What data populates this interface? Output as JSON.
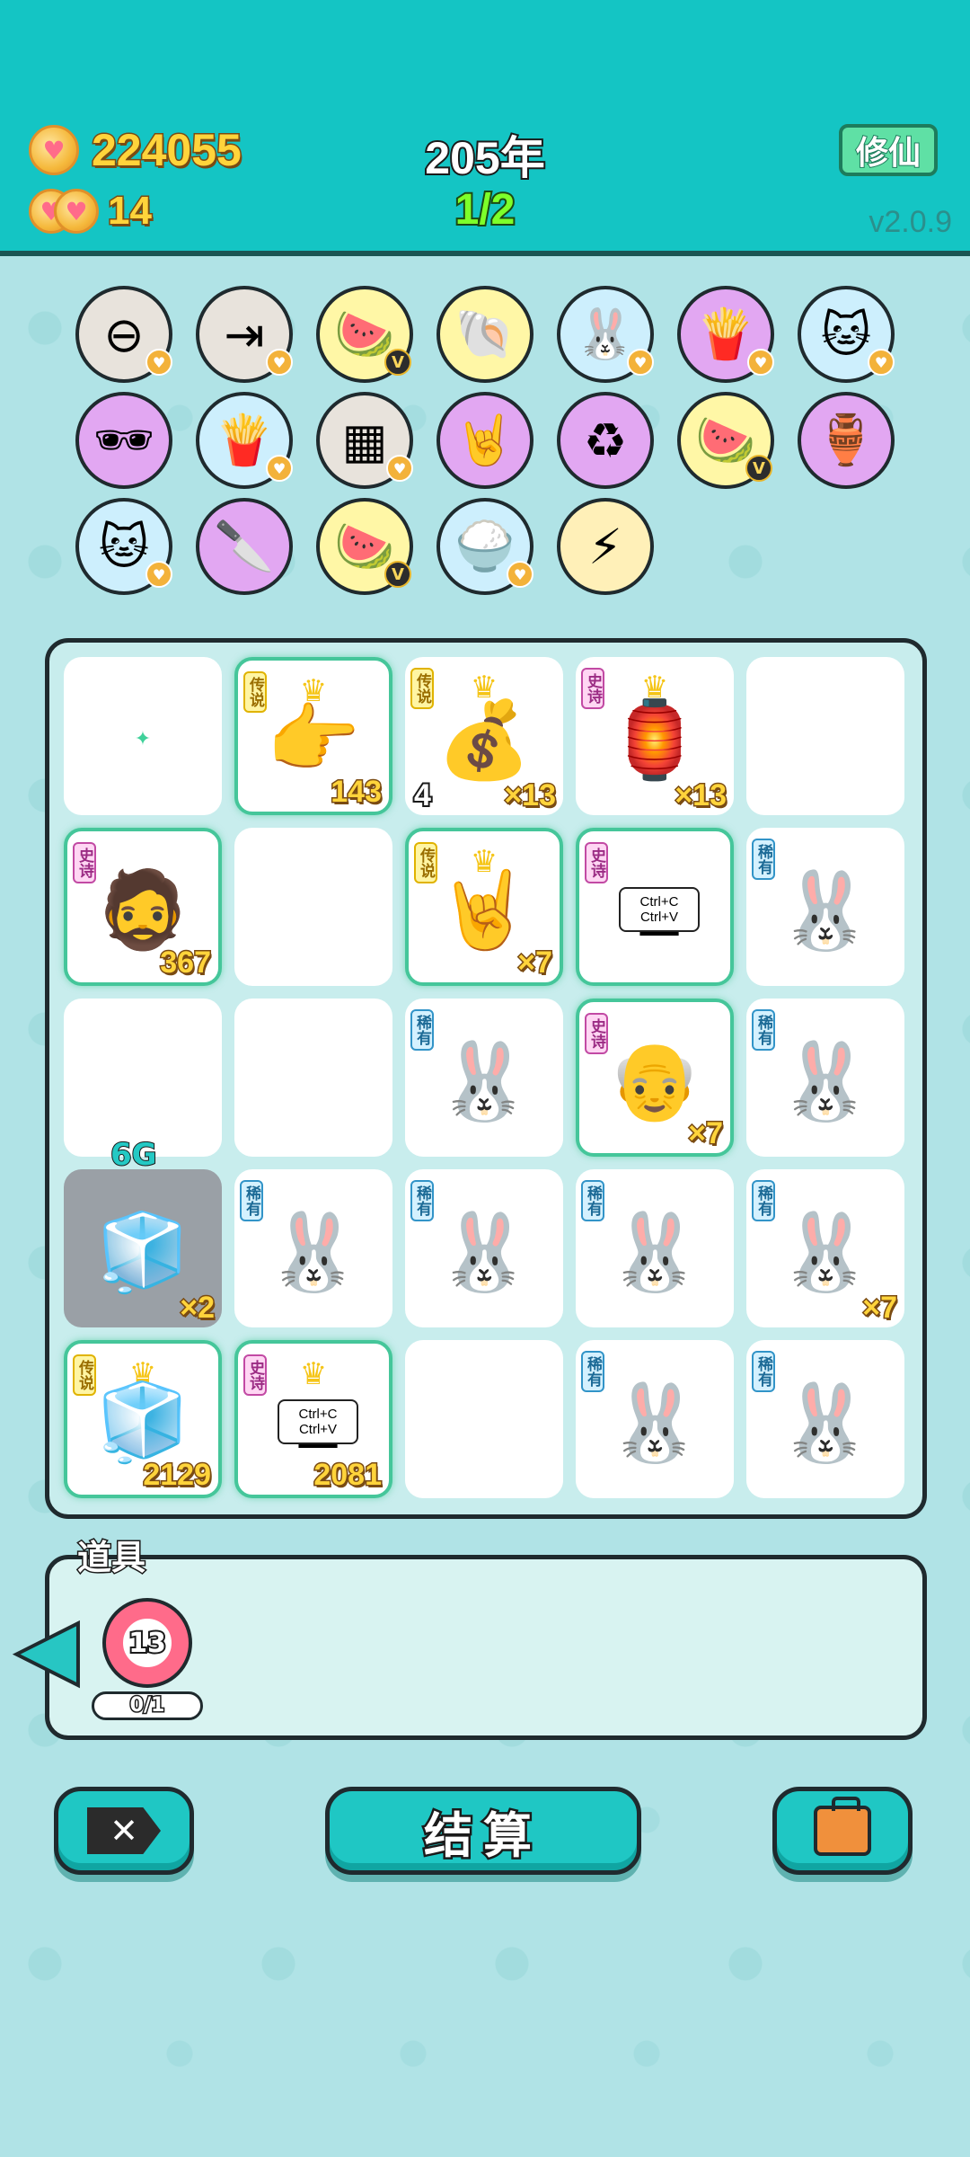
{
  "header": {
    "coins": "224055",
    "secondary": "14",
    "year": "205年",
    "progress": "1/2",
    "mode_button": "修仙",
    "version": "v2.0.9"
  },
  "symbols": [
    {
      "icon": "minus-circle-icon",
      "glyph": "⊖",
      "bg": "#e8e3dc",
      "badge": "heart"
    },
    {
      "icon": "skip-icon",
      "glyph": "⇥",
      "bg": "#e8e3dc",
      "badge": "heart"
    },
    {
      "icon": "fruit-basket-icon",
      "glyph": "🍉",
      "bg": "#fff7a6",
      "badge": "v"
    },
    {
      "icon": "shell-icon",
      "glyph": "🐚",
      "bg": "#fff7a6",
      "badge": ""
    },
    {
      "icon": "rabbit-icon",
      "glyph": "🐰",
      "bg": "#cdeffd",
      "badge": "heart"
    },
    {
      "icon": "fries-icon",
      "glyph": "🍟",
      "bg": "#e2a7f2",
      "badge": "heart"
    },
    {
      "icon": "cat-icon",
      "glyph": "🐱",
      "bg": "#cdeffd",
      "badge": "heart"
    },
    {
      "icon": "sunglasses-icon",
      "glyph": "🕶",
      "bg": "#e2a7f2",
      "badge": ""
    },
    {
      "icon": "fries-icon",
      "glyph": "🍟",
      "bg": "#cdeffd",
      "badge": "heart"
    },
    {
      "icon": "sugar-cubes-icon",
      "glyph": "▦",
      "bg": "#e8e3dc",
      "badge": "heart"
    },
    {
      "icon": "rock-hand-icon",
      "glyph": "🤘",
      "bg": "#e2a7f2",
      "badge": ""
    },
    {
      "icon": "recycle-icon",
      "glyph": "♻",
      "bg": "#e2a7f2",
      "badge": ""
    },
    {
      "icon": "fruit-basket-icon",
      "glyph": "🍉",
      "bg": "#fff7a6",
      "badge": "v"
    },
    {
      "icon": "jar-icon",
      "glyph": "🏺",
      "bg": "#e2a7f2",
      "badge": ""
    },
    {
      "icon": "cat-icon",
      "glyph": "🐱",
      "bg": "#cdeffd",
      "badge": "heart"
    },
    {
      "icon": "cleaver-icon",
      "glyph": "🔪",
      "bg": "#e2a7f2",
      "badge": ""
    },
    {
      "icon": "fruit-basket-icon",
      "glyph": "🍉",
      "bg": "#fff7a6",
      "badge": "v"
    },
    {
      "icon": "rice-bowl-icon",
      "glyph": "🍚",
      "bg": "#cdeffd",
      "badge": "heart"
    },
    {
      "icon": "lightning-icon",
      "glyph": "⚡",
      "bg": "#fff0b8",
      "badge": ""
    }
  ],
  "board": {
    "cells": [
      {
        "icon": "sparkle-icon",
        "glyph": "✦",
        "rarity": "",
        "count": "",
        "glow": false
      },
      {
        "icon": "pointing-hand-icon",
        "glyph": "👉",
        "rarity": "legend",
        "count": "143",
        "glow": true,
        "crown": true
      },
      {
        "icon": "sack-icon",
        "glyph": "💰",
        "rarity": "legend",
        "count": "×13",
        "left": "4",
        "glow": false,
        "crown": true
      },
      {
        "icon": "lantern-house-icon",
        "glyph": "🏮",
        "rarity": "epic",
        "count": "×13",
        "glow": false,
        "crown": true
      },
      {
        "icon": "",
        "glyph": "",
        "rarity": "",
        "count": "",
        "glow": false
      },
      {
        "icon": "bearded-man-icon",
        "glyph": "🧔",
        "rarity": "epic",
        "count": "367",
        "glow": true
      },
      {
        "icon": "",
        "glyph": "",
        "rarity": "",
        "count": "",
        "glow": false
      },
      {
        "icon": "rock-hand-icon",
        "glyph": "🤘",
        "rarity": "legend",
        "count": "×7",
        "glow": true,
        "crown": true
      },
      {
        "icon": "copy-paste-icon",
        "glyph": "⧉",
        "rarity": "epic",
        "count": "",
        "glow": true,
        "caption": "Ctrl+C Ctrl+V"
      },
      {
        "icon": "rabbit-icon",
        "glyph": "🐰",
        "rarity": "rare",
        "count": "",
        "glow": false
      },
      {
        "icon": "",
        "glyph": "",
        "rarity": "",
        "count": "",
        "glow": false
      },
      {
        "icon": "",
        "glyph": "",
        "rarity": "",
        "count": "",
        "glow": false
      },
      {
        "icon": "rabbit-icon",
        "glyph": "🐰",
        "rarity": "rare",
        "count": "",
        "glow": false
      },
      {
        "icon": "old-man-hat-icon",
        "glyph": "👴",
        "rarity": "epic",
        "count": "×7",
        "glow": true
      },
      {
        "icon": "rabbit-icon",
        "glyph": "🐰",
        "rarity": "rare",
        "count": "",
        "glow": false
      },
      {
        "icon": "fridge-icon",
        "glyph": "🧊",
        "rarity": "",
        "count": "×2",
        "glow": false,
        "special": "6G"
      },
      {
        "icon": "rabbit-icon",
        "glyph": "🐰",
        "rarity": "rare",
        "count": "",
        "glow": false
      },
      {
        "icon": "rabbit-icon",
        "glyph": "🐰",
        "rarity": "rare",
        "count": "",
        "glow": false
      },
      {
        "icon": "rabbit-icon",
        "glyph": "🐰",
        "rarity": "rare",
        "count": "",
        "glow": false
      },
      {
        "icon": "rabbit-icon",
        "glyph": "🐰",
        "rarity": "rare",
        "count": "×7",
        "glow": false
      },
      {
        "icon": "fridge-icon",
        "glyph": "🧊",
        "rarity": "legend",
        "count": "2129",
        "glow": true,
        "crown": true
      },
      {
        "icon": "copy-paste-icon",
        "glyph": "⧉",
        "rarity": "epic",
        "count": "2081",
        "glow": true,
        "crown": true,
        "caption": "Ctrl+C Ctrl+V"
      },
      {
        "icon": "",
        "glyph": "",
        "rarity": "",
        "count": "",
        "glow": false
      },
      {
        "icon": "rabbit-icon",
        "glyph": "🐰",
        "rarity": "rare",
        "count": "",
        "glow": false
      },
      {
        "icon": "rabbit-icon",
        "glyph": "🐰",
        "rarity": "rare",
        "count": "",
        "glow": false
      }
    ]
  },
  "rarity_labels": {
    "legend": "传说",
    "epic": "史诗",
    "rare": "稀有"
  },
  "items": {
    "title": "道具",
    "dart_count": "13",
    "dart_usage": "0/1"
  },
  "buttons": {
    "settle": "结算"
  }
}
